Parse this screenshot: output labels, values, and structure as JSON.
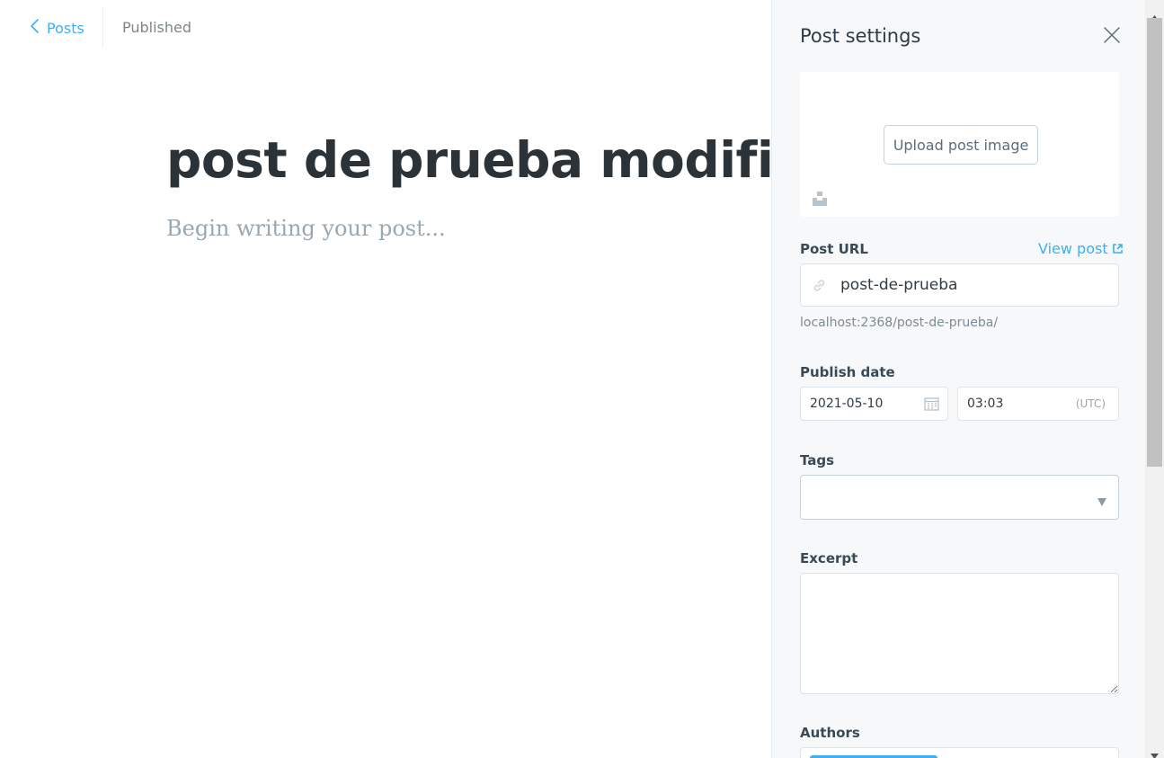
{
  "editor": {
    "back_label": "Posts",
    "status": "Published",
    "title": "post de prueba modificado",
    "body_placeholder": "Begin writing your post..."
  },
  "settings": {
    "title": "Post settings",
    "upload_image_label": "Upload post image",
    "post_url_label": "Post URL",
    "view_post_label": "View post",
    "slug_value": "post-de-prueba",
    "url_preview": "localhost:2368/post-de-prueba/",
    "publish_date_label": "Publish date",
    "date_value": "2021-05-10",
    "time_value": "03:03",
    "timezone": "(UTC)",
    "tags_label": "Tags",
    "excerpt_label": "Excerpt",
    "excerpt_value": "",
    "authors_label": "Authors"
  },
  "icons": {
    "back": "chevron-left-icon",
    "close": "close-icon",
    "unsplash": "unsplash-icon",
    "external_link": "external-link-icon",
    "link": "link-icon",
    "calendar": "calendar-icon",
    "dropdown": "caret-down-icon"
  },
  "colors": {
    "accent": "#3eb0ef",
    "panel_bg": "#f7f8fa",
    "title_text": "#2b3338",
    "placeholder_text": "#99a7b0"
  }
}
